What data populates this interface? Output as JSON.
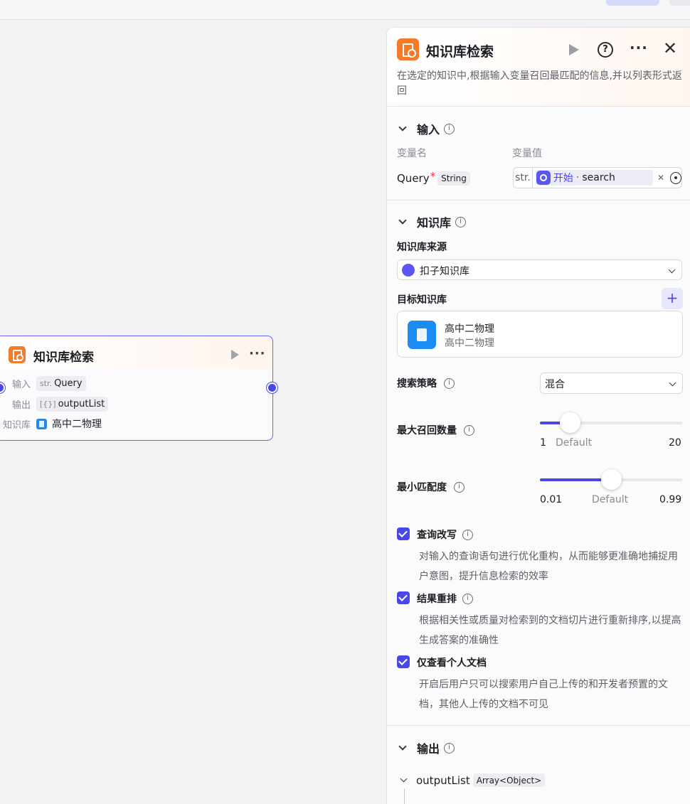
{
  "node": {
    "title": "知识库检索",
    "input_label": "输入",
    "input_type": "str.",
    "input_value": "Query",
    "output_label": "输出",
    "output_type": "[{}]",
    "output_value": "outputList",
    "kb_label": "知识库",
    "kb_value": "高中二物理"
  },
  "panel": {
    "title": "知识库检索",
    "description": "在选定的知识中,根据输入变量召回最匹配的信息,并以列表形式返回",
    "input_section": {
      "title": "输入",
      "col_name": "变量名",
      "col_value": "变量值",
      "param_name": "Query",
      "required_mark": "*",
      "param_type": "String",
      "value_type": "str.",
      "ref_source": "开始",
      "ref_sep": "·",
      "ref_var": "search"
    },
    "kb_section": {
      "title": "知识库",
      "source_label": "知识库来源",
      "source_value": "扣子知识库",
      "target_label": "目标知识库",
      "add_label": "+",
      "kb_name": "高中二物理",
      "kb_sub": "高中二物理",
      "strategy_label": "搜索策略",
      "strategy_value": "混合",
      "max_recall_label": "最大召回数量",
      "max_recall_min": "1",
      "max_recall_default": "Default",
      "max_recall_max": "20",
      "max_recall_value": 5,
      "min_match_label": "最小匹配度",
      "min_match_min": "0.01",
      "min_match_default": "Default",
      "min_match_max": "0.99",
      "min_match_value": 0.5,
      "query_rewrite_label": "查询改写",
      "query_rewrite_desc": "对输入的查询语句进行优化重构，从而能够更准确地捕捉用户意图，提升信息检索的效率",
      "rerank_label": "结果重排",
      "rerank_desc": "根据相关性或质量对检索到的文档切片进行重新排序,以提高生成答案的准确性",
      "personal_label": "仅查看个人文档",
      "personal_desc": "开启后用户只可以搜索用户自己上传的和开发者预置的文档，其他人上传的文档不可见"
    },
    "output_section": {
      "title": "输出",
      "var_name": "outputList",
      "var_type": "Array<Object>"
    }
  },
  "colors": {
    "accent": "#4a47e8",
    "brand_orange": "#f47b2a",
    "kb_blue": "#1c8cf5"
  }
}
